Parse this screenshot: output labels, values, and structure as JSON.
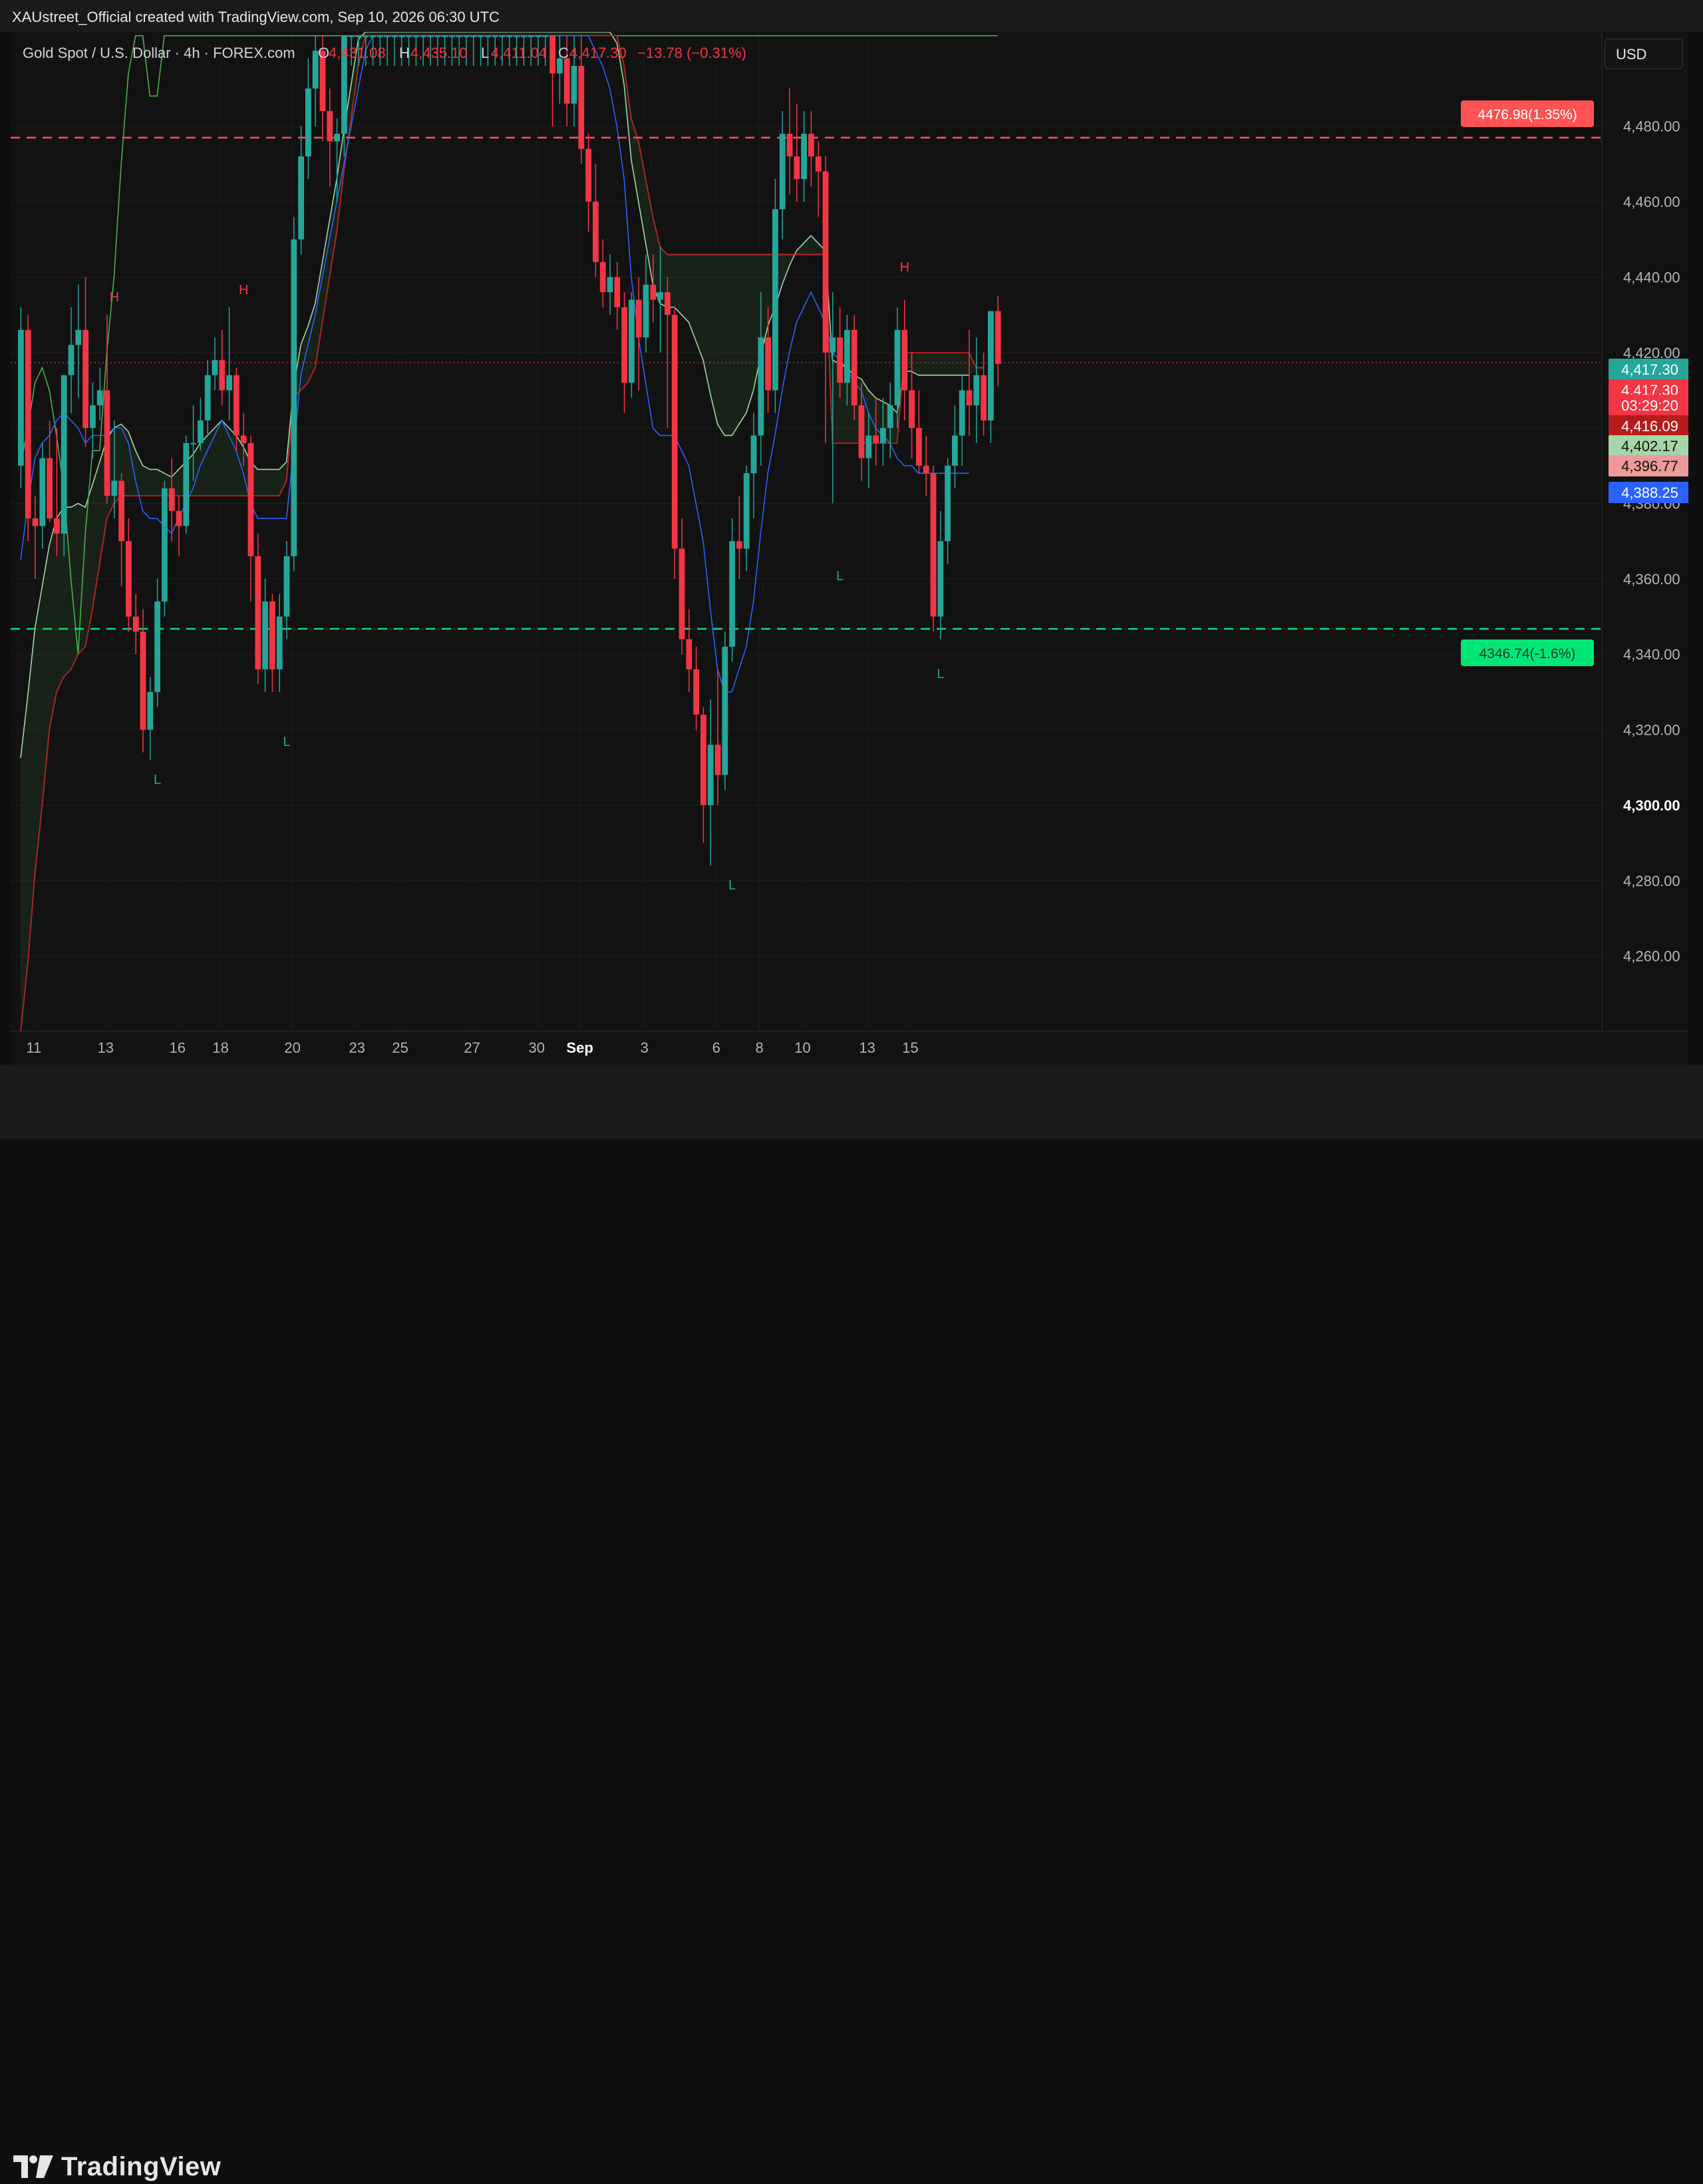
{
  "header": {
    "credit": "XAUstreet_Official created with TradingView.com, Sep 10, 2026 06:30 UTC"
  },
  "legend": {
    "symbol": "Gold Spot / U.S. Dollar · 4h · FOREX.com",
    "o_label": "O",
    "o_value": "4,431.08",
    "h_label": "H",
    "h_value": "4,435.10",
    "l_label": "L",
    "l_value": "4,411.04",
    "c_label": "C",
    "c_value": "4,417.30",
    "change": "−13.78 (−0.31%)"
  },
  "currency": "USD",
  "brand": {
    "name": "TradingView"
  },
  "colors": {
    "up": "#26a69a",
    "down": "#f23645",
    "kijun": "#b71c1c",
    "tenkan": "#2962ff",
    "chikou": "#4caf50",
    "span_a": "#a5d6a7",
    "span_b": "#ef9a9a",
    "target_up": "#ff5252",
    "target_down": "#00e676"
  },
  "chart_data": {
    "type": "candlestick",
    "timeframe": "4h",
    "ylim": [
      4240,
      4505
    ],
    "y_ticks": [
      "4,260.00",
      "4,280.00",
      "4,300.00",
      "4,320.00",
      "4,340.00",
      "4,360.00",
      "4,380.00",
      "4,400.00",
      "4,420.00",
      "4,440.00",
      "4,460.00",
      "4,480.00"
    ],
    "x_ticks": [
      "11",
      "13",
      "16",
      "18",
      "20",
      "23",
      "25",
      "27",
      "30",
      "Sep",
      "3",
      "6",
      "8",
      "10",
      "13",
      "15"
    ],
    "price_labels": [
      {
        "text": "4,417.30",
        "value": 4417.3,
        "color": "#26a69a"
      },
      {
        "text": "4,417.30",
        "value": 4417.3,
        "color": "#f23645"
      },
      {
        "text": "03:29:20",
        "value": 4417.3,
        "color": "#f23645"
      },
      {
        "text": "4,416.09",
        "value": 4416.09,
        "color": "#b71c1c"
      },
      {
        "text": "4,402.17",
        "value": 4402.17,
        "color": "#a5d6a7"
      },
      {
        "text": "4,396.77",
        "value": 4396.77,
        "color": "#ef9a9a"
      },
      {
        "text": "4,388.25",
        "value": 4388.25,
        "color": "#2962ff"
      }
    ],
    "targets": [
      {
        "text": "4476.98(1.35%)",
        "value": 4476.98,
        "color": "#ff5252"
      },
      {
        "text": "4346.74(-1.6%)",
        "value": 4346.74,
        "color": "#00e676"
      }
    ],
    "pivots": [
      {
        "type": "H",
        "bar": 13,
        "value": 4430
      },
      {
        "type": "L",
        "bar": 19,
        "value": 4312
      },
      {
        "type": "H",
        "bar": 31,
        "value": 4432
      },
      {
        "type": "L",
        "bar": 37,
        "value": 4322
      },
      {
        "type": "L",
        "bar": 99,
        "value": 4284
      },
      {
        "type": "L",
        "bar": 114,
        "value": 4366
      },
      {
        "type": "H",
        "bar": 123,
        "value": 4438
      },
      {
        "type": "L",
        "bar": 128,
        "value": 4340
      }
    ],
    "candles": [
      [
        4390,
        4432,
        4384,
        4426
      ],
      [
        4426,
        4430,
        4370,
        4376
      ],
      [
        4376,
        4382,
        4360,
        4374
      ],
      [
        4374,
        4396,
        4368,
        4392
      ],
      [
        4392,
        4402,
        4375,
        4376
      ],
      [
        4376,
        4400,
        4366,
        4372
      ],
      [
        4372,
        4406,
        4366,
        4414
      ],
      [
        4414,
        4432,
        4404,
        4422
      ],
      [
        4422,
        4438,
        4408,
        4426
      ],
      [
        4426,
        4440,
        4395,
        4400
      ],
      [
        4400,
        4412,
        4392,
        4406
      ],
      [
        4406,
        4416,
        4402,
        4410
      ],
      [
        4410,
        4430,
        4380,
        4382
      ],
      [
        4382,
        4402,
        4376,
        4386
      ],
      [
        4386,
        4388,
        4358,
        4370
      ],
      [
        4370,
        4376,
        4346,
        4350
      ],
      [
        4350,
        4356,
        4340,
        4346
      ],
      [
        4346,
        4352,
        4314,
        4320
      ],
      [
        4320,
        4334,
        4312,
        4330
      ],
      [
        4330,
        4360,
        4326,
        4354
      ],
      [
        4354,
        4386,
        4350,
        4384
      ],
      [
        4384,
        4392,
        4370,
        4378
      ],
      [
        4378,
        4382,
        4366,
        4374
      ],
      [
        4374,
        4398,
        4372,
        4396
      ],
      [
        4396,
        4406,
        4386,
        4396
      ],
      [
        4396,
        4408,
        4394,
        4402
      ],
      [
        4402,
        4418,
        4398,
        4414
      ],
      [
        4414,
        4424,
        4410,
        4418
      ],
      [
        4418,
        4426,
        4406,
        4410
      ],
      [
        4410,
        4432,
        4402,
        4414
      ],
      [
        4414,
        4416,
        4394,
        4398
      ],
      [
        4398,
        4404,
        4390,
        4396
      ],
      [
        4396,
        4398,
        4354,
        4366
      ],
      [
        4366,
        4372,
        4332,
        4336
      ],
      [
        4336,
        4360,
        4330,
        4354
      ],
      [
        4354,
        4356,
        4330,
        4336
      ],
      [
        4336,
        4356,
        4330,
        4350
      ],
      [
        4350,
        4370,
        4344,
        4366
      ],
      [
        4366,
        4456,
        4362,
        4450
      ],
      [
        4450,
        4480,
        4446,
        4472
      ],
      [
        4472,
        4498,
        4466,
        4490
      ],
      [
        4490,
        4504,
        4480,
        4500
      ],
      [
        4500,
        4504,
        4476,
        4484
      ],
      [
        4484,
        4490,
        4464,
        4476
      ],
      [
        4476,
        4482,
        4460,
        4478
      ],
      [
        4478,
        4504,
        4472,
        4504
      ],
      [
        4504,
        4504,
        4496,
        4504
      ],
      [
        4504,
        4504,
        4496,
        4504
      ],
      [
        4504,
        4504,
        4496,
        4504
      ],
      [
        4504,
        4504,
        4496,
        4504
      ],
      [
        4504,
        4504,
        4496,
        4504
      ],
      [
        4504,
        4504,
        4496,
        4504
      ],
      [
        4504,
        4504,
        4496,
        4504
      ],
      [
        4504,
        4504,
        4496,
        4504
      ],
      [
        4504,
        4504,
        4496,
        4504
      ],
      [
        4504,
        4504,
        4496,
        4504
      ],
      [
        4504,
        4504,
        4496,
        4504
      ],
      [
        4504,
        4504,
        4496,
        4504
      ],
      [
        4504,
        4504,
        4496,
        4504
      ],
      [
        4504,
        4504,
        4496,
        4504
      ],
      [
        4504,
        4504,
        4496,
        4504
      ],
      [
        4504,
        4504,
        4496,
        4504
      ],
      [
        4504,
        4504,
        4496,
        4504
      ],
      [
        4504,
        4504,
        4496,
        4504
      ],
      [
        4504,
        4504,
        4496,
        4504
      ],
      [
        4504,
        4504,
        4496,
        4504
      ],
      [
        4504,
        4504,
        4496,
        4504
      ],
      [
        4504,
        4504,
        4496,
        4504
      ],
      [
        4504,
        4504,
        4496,
        4504
      ],
      [
        4504,
        4504,
        4496,
        4504
      ],
      [
        4504,
        4504,
        4496,
        4504
      ],
      [
        4504,
        4504,
        4496,
        4504
      ],
      [
        4504,
        4504,
        4496,
        4504
      ],
      [
        4504,
        4504,
        4496,
        4504
      ],
      [
        4504,
        4504,
        4480,
        4494
      ],
      [
        4494,
        4504,
        4486,
        4498
      ],
      [
        4498,
        4504,
        4480,
        4486
      ],
      [
        4486,
        4504,
        4480,
        4496
      ],
      [
        4496,
        4504,
        4470,
        4474
      ],
      [
        4474,
        4478,
        4452,
        4460
      ],
      [
        4460,
        4470,
        4440,
        4444
      ],
      [
        4444,
        4450,
        4432,
        4436
      ],
      [
        4436,
        4446,
        4430,
        4440
      ],
      [
        4440,
        4444,
        4426,
        4432
      ],
      [
        4432,
        4436,
        4404,
        4412
      ],
      [
        4412,
        4436,
        4408,
        4434
      ],
      [
        4434,
        4440,
        4410,
        4424
      ],
      [
        4424,
        4446,
        4420,
        4438
      ],
      [
        4438,
        4446,
        4428,
        4434
      ],
      [
        4434,
        4448,
        4420,
        4436
      ],
      [
        4436,
        4440,
        4400,
        4430
      ],
      [
        4430,
        4432,
        4360,
        4368
      ],
      [
        4368,
        4376,
        4340,
        4344
      ],
      [
        4344,
        4352,
        4330,
        4336
      ],
      [
        4336,
        4342,
        4320,
        4324
      ],
      [
        4324,
        4326,
        4290,
        4300
      ],
      [
        4300,
        4328,
        4284,
        4316
      ],
      [
        4316,
        4336,
        4300,
        4308
      ],
      [
        4308,
        4346,
        4304,
        4342
      ],
      [
        4342,
        4376,
        4338,
        4370
      ],
      [
        4370,
        4382,
        4360,
        4368
      ],
      [
        4368,
        4390,
        4362,
        4388
      ],
      [
        4388,
        4404,
        4376,
        4398
      ],
      [
        4398,
        4436,
        4390,
        4424
      ],
      [
        4424,
        4432,
        4404,
        4410
      ],
      [
        4410,
        4466,
        4404,
        4458
      ],
      [
        4458,
        4484,
        4450,
        4478
      ],
      [
        4478,
        4490,
        4462,
        4472
      ],
      [
        4472,
        4486,
        4460,
        4466
      ],
      [
        4466,
        4484,
        4460,
        4478
      ],
      [
        4478,
        4484,
        4464,
        4472
      ],
      [
        4472,
        4476,
        4456,
        4468
      ],
      [
        4468,
        4472,
        4396,
        4420
      ],
      [
        4420,
        4436,
        4380,
        4424
      ],
      [
        4424,
        4432,
        4408,
        4412
      ],
      [
        4412,
        4430,
        4406,
        4426
      ],
      [
        4426,
        4430,
        4402,
        4406
      ],
      [
        4406,
        4412,
        4386,
        4392
      ],
      [
        4392,
        4404,
        4384,
        4398
      ],
      [
        4398,
        4408,
        4390,
        4396
      ],
      [
        4396,
        4408,
        4390,
        4400
      ],
      [
        4400,
        4412,
        4392,
        4406
      ],
      [
        4406,
        4432,
        4400,
        4426
      ],
      [
        4426,
        4434,
        4402,
        4410
      ],
      [
        4410,
        4420,
        4392,
        4400
      ],
      [
        4400,
        4410,
        4388,
        4390
      ],
      [
        4390,
        4398,
        4382,
        4388
      ],
      [
        4388,
        4390,
        4346,
        4350
      ],
      [
        4350,
        4378,
        4344,
        4370
      ],
      [
        4370,
        4392,
        4364,
        4390
      ],
      [
        4390,
        4406,
        4384,
        4398
      ],
      [
        4398,
        4414,
        4390,
        4410
      ],
      [
        4410,
        4426,
        4398,
        4406
      ],
      [
        4406,
        4424,
        4396,
        4414
      ],
      [
        4414,
        4420,
        4398,
        4402
      ],
      [
        4402,
        4430,
        4396,
        4431
      ],
      [
        4431,
        4435,
        4411,
        4417
      ]
    ],
    "tenkan": [
      4365,
      4380,
      4392,
      4396,
      4398,
      4402,
      4404,
      4402,
      4400,
      4396,
      4398,
      4398,
      4398,
      4400,
      4400,
      4396,
      4386,
      4378,
      4376,
      4376,
      4374,
      4372,
      4376,
      4380,
      4384,
      4390,
      4394,
      4398,
      4402,
      4398,
      4394,
      4388,
      4380,
      4376,
      4376,
      4376,
      4376,
      4376,
      4394,
      4414,
      4422,
      4430,
      4440,
      4450,
      4460,
      4470,
      4480,
      4490,
      4500,
      4504,
      4504,
      4504,
      4504,
      4504,
      4504,
      4504,
      4504,
      4504,
      4504,
      4504,
      4504,
      4504,
      4504,
      4504,
      4504,
      4504,
      4504,
      4504,
      4504,
      4504,
      4504,
      4504,
      4504,
      4504,
      4504,
      4504,
      4504,
      4504,
      4504,
      4504,
      4500,
      4496,
      4490,
      4480,
      4466,
      4440,
      4424,
      4412,
      4400,
      4398,
      4398,
      4398,
      4394,
      4390,
      4380,
      4370,
      4352,
      4336,
      4330,
      4330,
      4336,
      4342,
      4354,
      4372,
      4388,
      4398,
      4410,
      4420,
      4428,
      4432,
      4436,
      4432,
      4428,
      4420,
      4418,
      4416,
      4412,
      4410,
      4404,
      4400,
      4398,
      4396,
      4392,
      4390,
      4390,
      4388,
      4388,
      4388,
      4388,
      4388,
      4388,
      4388,
      4388
    ],
    "kijun": [
      4240,
      4258,
      4282,
      4300,
      4320,
      4330,
      4334,
      4336,
      4340,
      4342,
      4352,
      4364,
      4376,
      4380,
      4382,
      4382,
      4382,
      4382,
      4382,
      4382,
      4382,
      4382,
      4382,
      4382,
      4382,
      4382,
      4382,
      4382,
      4382,
      4382,
      4382,
      4382,
      4382,
      4382,
      4382,
      4382,
      4382,
      4386,
      4408,
      4410,
      4412,
      4416,
      4428,
      4440,
      4452,
      4468,
      4482,
      4496,
      4504,
      4504,
      4504,
      4504,
      4504,
      4504,
      4504,
      4504,
      4504,
      4504,
      4504,
      4504,
      4504,
      4504,
      4504,
      4504,
      4504,
      4504,
      4504,
      4504,
      4504,
      4504,
      4504,
      4504,
      4504,
      4504,
      4504,
      4504,
      4504,
      4504,
      4504,
      4504,
      4504,
      4504,
      4504,
      4504,
      4496,
      4482,
      4476,
      4466,
      4456,
      4448,
      4446,
      4446,
      4446,
      4446,
      4446,
      4446,
      4446,
      4446,
      4446,
      4446,
      4446,
      4446,
      4446,
      4446,
      4446,
      4446,
      4446,
      4446,
      4446,
      4446,
      4446,
      4446,
      4446,
      4396,
      4396,
      4396,
      4396,
      4396,
      4396,
      4396,
      4396,
      4396,
      4396,
      4420,
      4420,
      4420,
      4420,
      4420,
      4420,
      4420,
      4420,
      4420,
      4420,
      4416,
      4416
    ],
    "chikou": [
      4390,
      4400,
      4412,
      4416,
      4410,
      4398,
      4384,
      4360,
      4340,
      4372,
      4394,
      4394,
      4420,
      4440,
      4470,
      4494,
      4504,
      4504,
      4488,
      4488,
      4504,
      4504,
      4504,
      4504,
      4504,
      4504,
      4504,
      4504,
      4504,
      4504,
      4504,
      4504,
      4504,
      4504,
      4504,
      4504,
      4504,
      4504,
      4504,
      4504,
      4504,
      4504,
      4504,
      4504,
      4504,
      4504,
      4504,
      4504,
      4504,
      4504,
      4504,
      4504,
      4504,
      4504,
      4504,
      4504,
      4504,
      4504,
      4504,
      4504,
      4504,
      4504,
      4504,
      4504,
      4504,
      4504,
      4504,
      4504,
      4504,
      4504,
      4504,
      4504,
      4504,
      4504,
      4504,
      4504,
      4504,
      4504,
      4504,
      4504,
      4504,
      4504,
      4504,
      4504,
      4504,
      4504,
      4504,
      4504,
      4504,
      4504,
      4504,
      4504,
      4504,
      4504,
      4504,
      4504,
      4504,
      4504,
      4504,
      4504,
      4504,
      4504,
      4504,
      4504,
      4504,
      4504,
      4504,
      4504,
      4504,
      4504,
      4504,
      4504,
      4504,
      4504,
      4504,
      4504,
      4504,
      4504,
      4504,
      4504,
      4504,
      4504,
      4504,
      4504,
      4504,
      4504,
      4504,
      4504,
      4504,
      4504,
      4504,
      4504,
      4504,
      4504,
      4504,
      4504,
      4504
    ]
  }
}
